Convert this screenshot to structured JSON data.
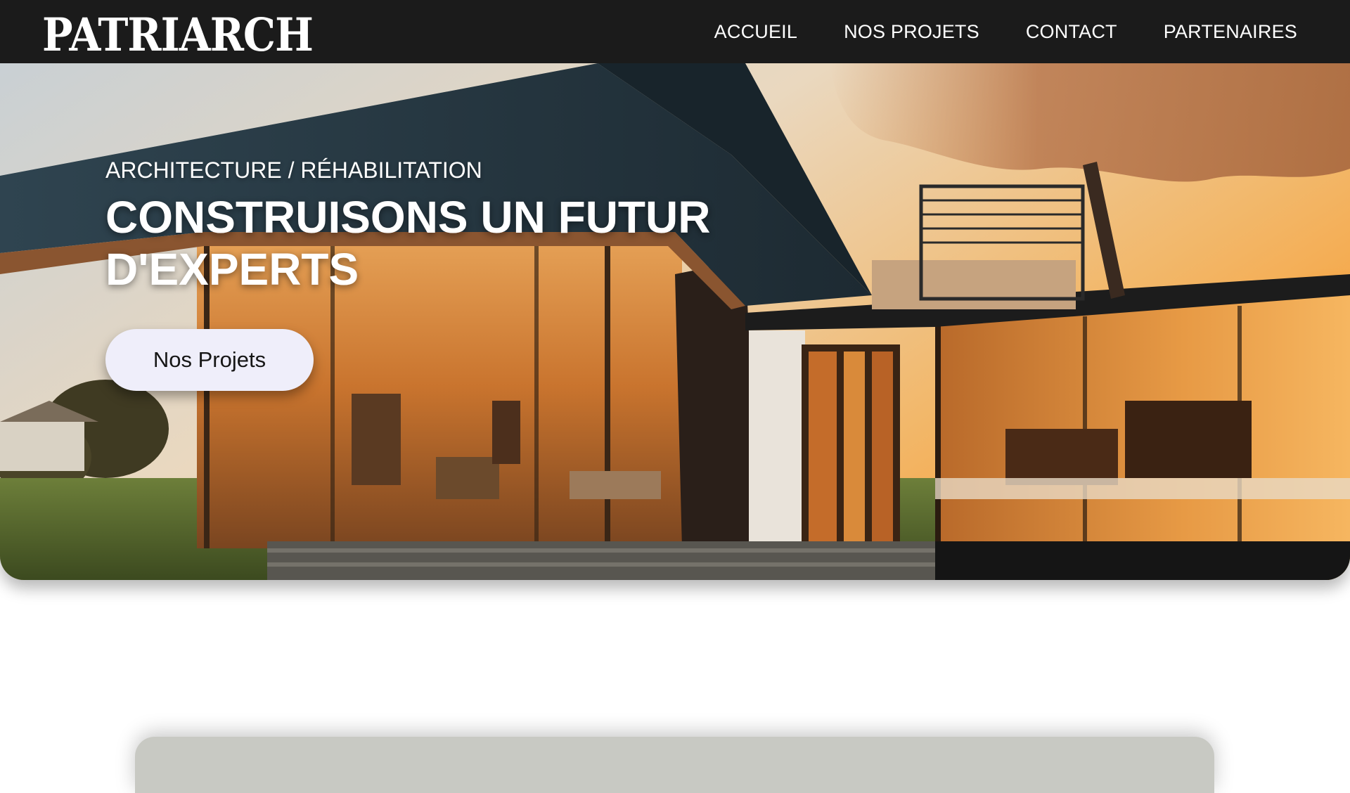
{
  "header": {
    "logo": "PATRIARCH",
    "nav": [
      {
        "label": "ACCUEIL"
      },
      {
        "label": "NOS PROJETS"
      },
      {
        "label": "CONTACT"
      },
      {
        "label": "PARTENAIRES"
      }
    ]
  },
  "hero": {
    "eyebrow": "ARCHITECTURE / RÉHABILITATION",
    "title": "CONSTRUISONS UN FUTUR\nD'EXPERTS",
    "cta_label": "Nos Projets"
  },
  "colors": {
    "header_bg": "#1b1b1b",
    "button_bg": "#efeefa",
    "card_bg": "#c8c9c3"
  }
}
